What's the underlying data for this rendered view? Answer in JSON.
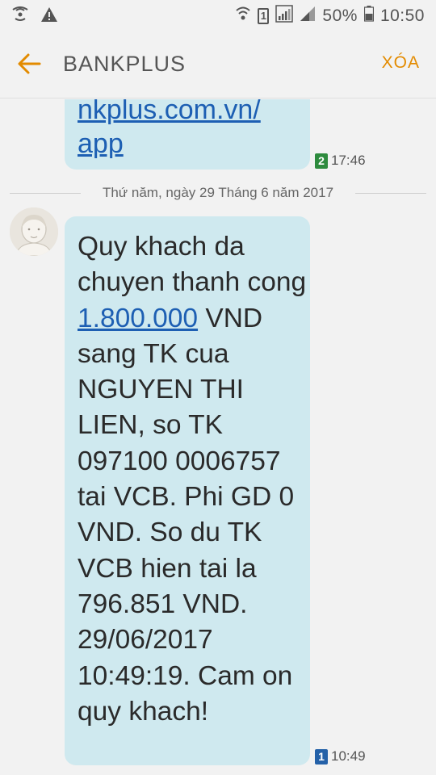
{
  "status_bar": {
    "battery_percent": "50%",
    "time": "10:50",
    "sim_slot": "1"
  },
  "app_bar": {
    "title": "BANKPLUS",
    "delete_label": "XÓA"
  },
  "messages": [
    {
      "text": "nkplus.com.vn/\napp",
      "sim": "2",
      "time": "17:46"
    },
    {
      "text_before_link": "Quy khach da chuyen thanh cong ",
      "link_text": "1.800.000",
      "text_after_link": " VND sang TK cua NGUYEN THI LIEN, so TK 097100 0006757 tai VCB. Phi GD 0 VND. So du TK VCB hien tai la 796.851 VND. 29/06/2017 10:49:19. Cam on quy khach!",
      "sim": "1",
      "time": "10:49"
    }
  ],
  "date_separator": "Thứ năm, ngày 29 Tháng 6 năm 2017",
  "colors": {
    "accent": "#e38b00",
    "bubble": "#cfe9ef",
    "link": "#1d5fb3",
    "sim1": "#2461a8",
    "sim2": "#2e8b3e"
  }
}
